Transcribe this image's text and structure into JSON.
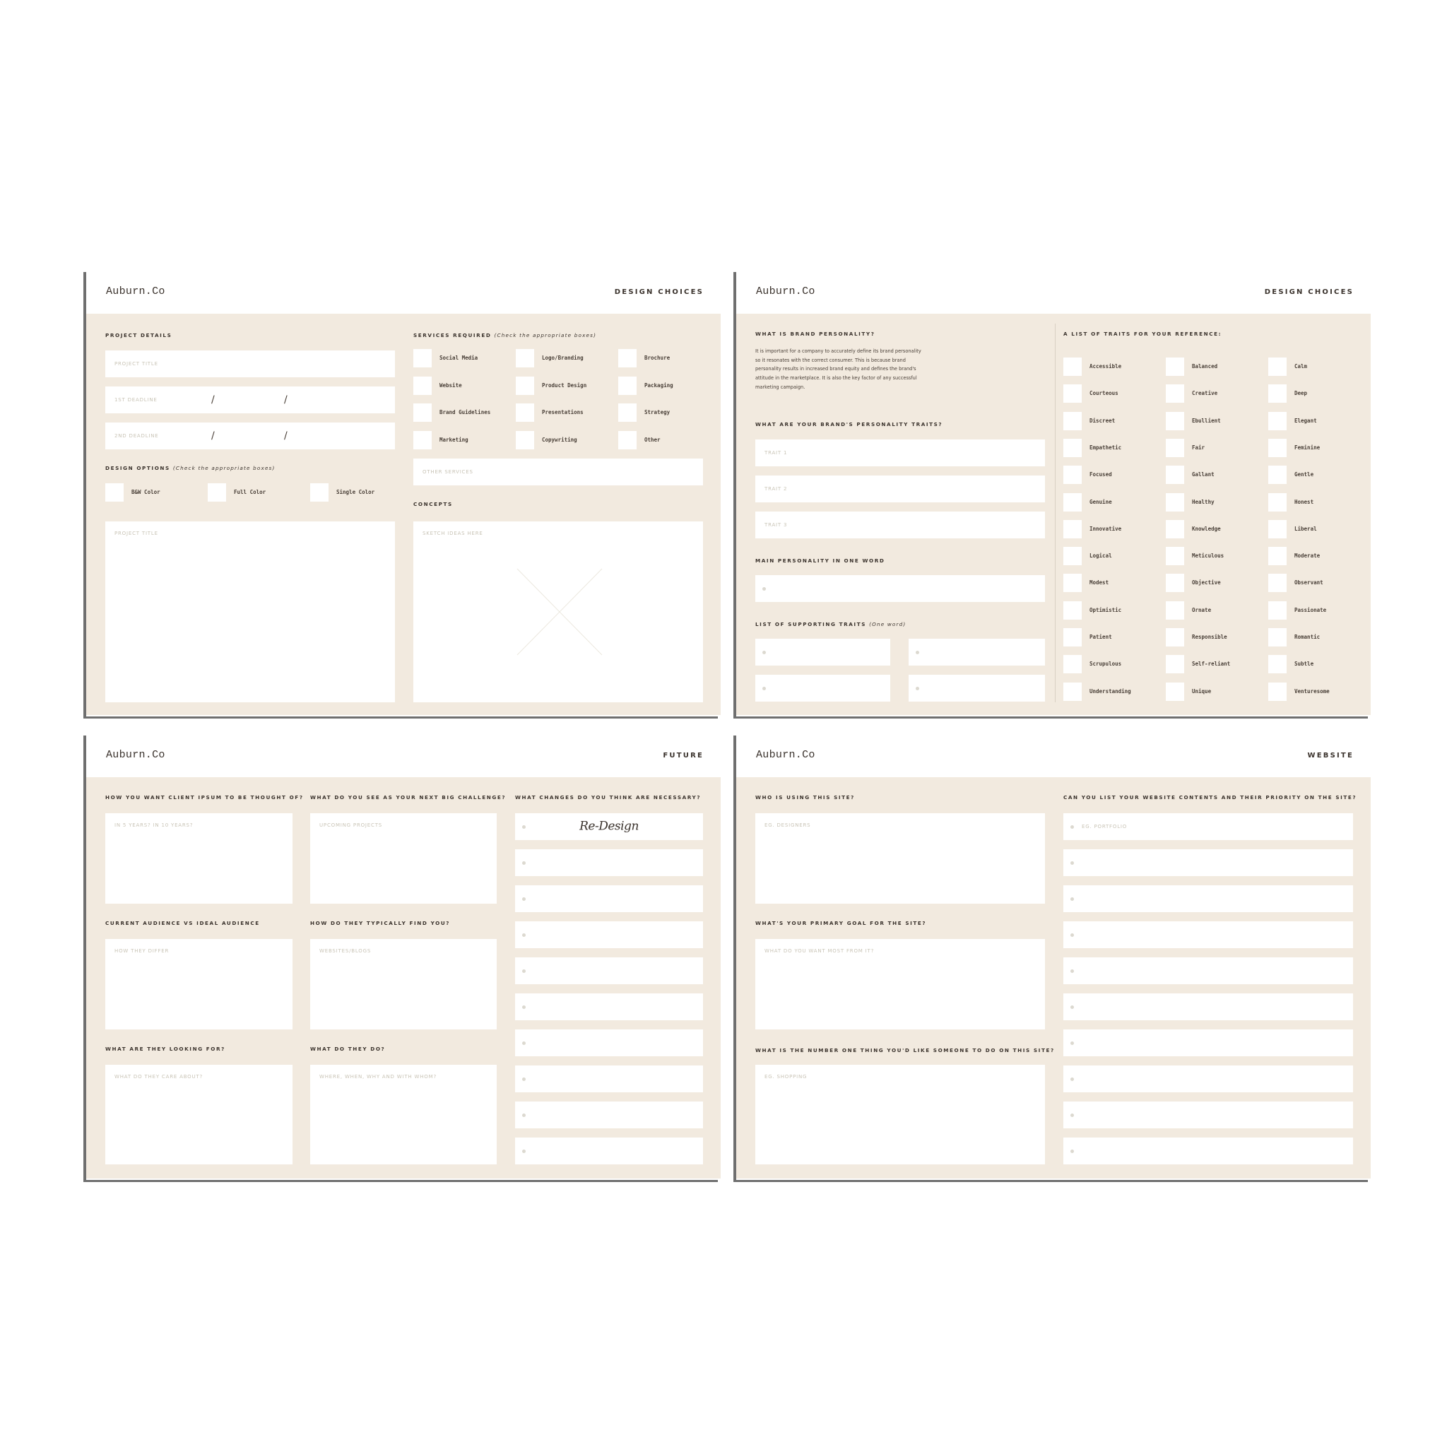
{
  "brand": "Auburn.Co",
  "panels": {
    "design_choices_1": {
      "section_title": "DESIGN CHOICES",
      "project_details": {
        "label": "PROJECT DETAILS",
        "project_title_placeholder": "PROJECT TITLE",
        "deadline1_placeholder": "1ST DEADLINE",
        "deadline2_placeholder": "2ND DEADLINE",
        "date_separator": "/"
      },
      "design_options": {
        "label": "DESIGN OPTIONS",
        "hint": "(Check  the appropriate boxes)",
        "options": [
          "B&W Color",
          "Full Color",
          "Single Color"
        ]
      },
      "notes_placeholder": "PROJECT TITLE",
      "services": {
        "label": "SERVICES REQUIRED",
        "hint": "(Check  the appropriate boxes)",
        "items": [
          "Social Media",
          "Logo/Branding",
          "Brochure",
          "Website",
          "Product Design",
          "Packaging",
          "Brand Guidelines",
          "Presentations",
          "Strategy",
          "Marketing",
          "Copywriting",
          "Other"
        ],
        "other_placeholder": "OTHER SERVICES"
      },
      "concepts": {
        "label": "CONCEPTS",
        "sketch_placeholder": "SKETCH IDEAS HERE"
      }
    },
    "design_choices_2": {
      "section_title": "DESIGN CHOICES",
      "what_is": {
        "label": "WHAT IS BRAND PERSONALITY?",
        "paragraph_lines": [
          "It is important for a company to accurately define its brand personality",
          "so it resonates with the correct consumer. This is because brand",
          "personality results in increased brand equity and defines the brand's",
          "attitude in the marketplace.  It is also the key factor of any successful",
          "marketing campaign."
        ]
      },
      "traits_question": "WHAT ARE YOUR BRAND'S PERSONALITY TRAITS?",
      "trait_placeholders": [
        "TRAIT 1",
        "TRAIT 2",
        "TRAIT 3"
      ],
      "main_personality_label": "MAIN PERSONALITY IN ONE WORD",
      "supporting": {
        "label": "LIST OF SUPPORTING TRAITS",
        "hint": "(One word)"
      },
      "reference": {
        "label": "A LIST OF TRAITS FOR YOUR REFERENCE:",
        "traits": [
          "Accessible",
          "Balanced",
          "Calm",
          "Courteous",
          "Creative",
          "Deep",
          "Discreet",
          "Ebullient",
          "Elegant",
          "Empathetic",
          "Fair",
          "Feminine",
          "Focused",
          "Gallant",
          "Gentle",
          "Genuine",
          "Healthy",
          "Honest",
          "Innovative",
          "Knowledge",
          "Liberal",
          "Logical",
          "Meticulous",
          "Moderate",
          "Modest",
          "Objective",
          "Observant",
          "Optimistic",
          "Ornate",
          "Passionate",
          "Patient",
          "Responsible",
          "Romantic",
          "Scrupulous",
          "Self-reliant",
          "Subtle",
          "Understanding",
          "Unique",
          "Venturesome"
        ]
      }
    },
    "future": {
      "section_title": "FUTURE",
      "q1": {
        "label": "HOW YOU WANT CLIENT IPSUM TO BE THOUGHT OF?",
        "placeholder": "IN 5 YEARS? IN 10 YEARS?"
      },
      "q2": {
        "label": "WHAT DO YOU SEE AS YOUR NEXT BIG CHALLENGE?",
        "placeholder": "UPCOMING PROJECTS"
      },
      "q3": {
        "label": "CURRENT AUDIENCE VS IDEAL AUDIENCE",
        "placeholder": "HOW THEY DIFFER"
      },
      "q4": {
        "label": "HOW DO THEY TYPICALLY FIND YOU?",
        "placeholder": "WEBSITES/BLOGS"
      },
      "q5": {
        "label": "WHAT ARE THEY LOOKING FOR?",
        "placeholder": "WHAT DO THEY CARE ABOUT?"
      },
      "q6": {
        "label": "WHAT DO THEY DO?",
        "placeholder": "WHERE, WHEN, WHY AND WITH WHOM?"
      },
      "changes": {
        "label": "WHAT CHANGES DO YOU THINK ARE NECESSARY?",
        "items": [
          "Re-Design",
          "",
          "",
          "",
          "",
          "",
          "",
          "",
          "",
          ""
        ]
      }
    },
    "website": {
      "section_title": "WEBSITE",
      "q1": {
        "label": "WHO IS USING THIS SITE?",
        "placeholder": "EG. DESIGNERS"
      },
      "q2": {
        "label": "WHAT'S YOUR PRIMARY GOAL FOR THE SITE?",
        "placeholder": "WHAT DO YOU WANT MOST FROM IT?"
      },
      "q3": {
        "label": "WHAT IS THE NUMBER ONE THING YOU'D LIKE SOMEONE TO DO ON THIS SITE?",
        "placeholder": "EG. SHOPPING"
      },
      "contents": {
        "label": "CAN YOU LIST YOUR WEBSITE CONTENTS AND THEIR PRIORITY ON THE SITE?",
        "first_placeholder": "EG. PORTFOLIO",
        "rows": 10
      }
    }
  }
}
